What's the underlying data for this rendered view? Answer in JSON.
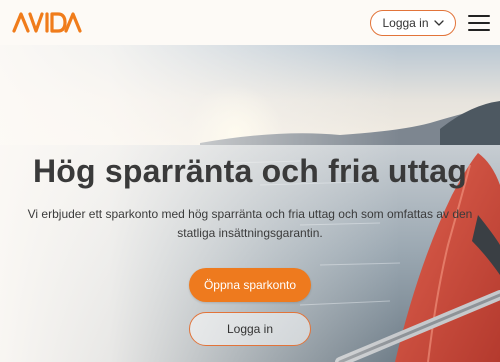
{
  "header": {
    "logo_text": "AVIDA",
    "login_label": "Logga in",
    "menu_icon": "hamburger-menu-icon",
    "chevron_icon": "chevron-down-icon"
  },
  "hero": {
    "title": "Hög sparränta och fria uttag",
    "subtitle": "Vi erbjuder ett sparkonto med hög sparränta och fria uttag och som omfattas av den statliga insättningsgarantin.",
    "primary_button": "Öppna sparkonto",
    "secondary_button": "Logga in"
  },
  "colors": {
    "brand_orange": "#ee7a1e",
    "background": "#fdfaf6",
    "text": "#333333"
  }
}
